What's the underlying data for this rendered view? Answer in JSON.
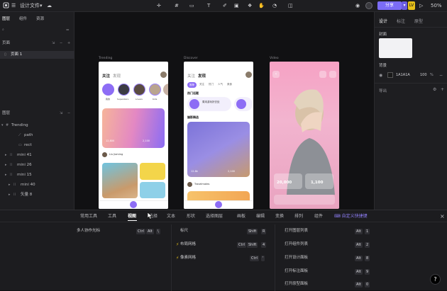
{
  "topbar": {
    "file_title": "设计文件",
    "share_label": "分享",
    "badge": "LV",
    "zoom": "50%"
  },
  "left": {
    "tabs": [
      "图层",
      "组件",
      "资源"
    ],
    "pages_label": "页面",
    "page_item": "页面 1",
    "layers_label": "图层",
    "layers": [
      {
        "name": "Trending"
      },
      {
        "name": "path"
      },
      {
        "name": "rect"
      },
      {
        "name": "mini 41"
      },
      {
        "name": "mini 26"
      },
      {
        "name": "mini 15"
      },
      {
        "name": "mini 40"
      },
      {
        "name": "矢量 8"
      }
    ]
  },
  "canvas": {
    "artboards": [
      "Trending",
      "Discover",
      "Video"
    ],
    "phone1": {
      "title_a": "关注",
      "title_b": "发现",
      "stories": [
        "我的",
        "Superstars",
        "Lovers",
        "Kids",
        "Ghost"
      ],
      "card_stat_a": "12,800",
      "card_stat_b": "2,100",
      "user": "Liu Jiaming"
    },
    "phone2": {
      "tabs": [
        "推荐",
        "关注",
        "热门",
        "人气",
        "美食"
      ],
      "section_a": "热门话题",
      "topic_a": "周末游玩好去处",
      "section_b": "摄影精选",
      "stat_a": "12.8k",
      "stat_b": "2,100",
      "user": "Travelmates"
    },
    "phone3": {
      "stat_a": "20,000",
      "stat_b": "1,100"
    }
  },
  "right": {
    "tabs": [
      "设计",
      "标注",
      "原型"
    ],
    "cover_label": "封面",
    "bg_label": "背景",
    "bg_hex": "1A1A1A",
    "bg_opacity": "100",
    "export_label": "导出"
  },
  "bottom": {
    "tabs": [
      "常用工具",
      "工具",
      "视图",
      "选择",
      "文本",
      "形状",
      "选择图层",
      "画板",
      "编辑",
      "变换",
      "排列",
      "组件",
      "自定义快捷键"
    ],
    "col1": [
      {
        "label": "多人协作光标",
        "keys": [
          "Ctrl",
          "Alt",
          "\\"
        ]
      }
    ],
    "col2": [
      {
        "label": "标尺",
        "keys": [
          "Shift",
          "R"
        ]
      },
      {
        "label": "布局网格",
        "keys": [
          "Ctrl",
          "Shift",
          "4"
        ]
      },
      {
        "label": "像素网格",
        "keys": [
          "Ctrl",
          "'"
        ]
      }
    ],
    "col3": [
      {
        "label": "打开图层列表",
        "keys": [
          "Alt",
          "1"
        ]
      },
      {
        "label": "打开组件列表",
        "keys": [
          "Alt",
          "2"
        ]
      },
      {
        "label": "打开设计面板",
        "keys": [
          "Alt",
          "8"
        ]
      },
      {
        "label": "打开标注面板",
        "keys": [
          "Alt",
          "9"
        ]
      },
      {
        "label": "打开原型面板",
        "keys": [
          "Alt",
          "0"
        ]
      }
    ]
  },
  "colors": {
    "accent": "#7b6cf6",
    "badge": "#e8c21a",
    "bg_dark": "#1e1e21"
  }
}
